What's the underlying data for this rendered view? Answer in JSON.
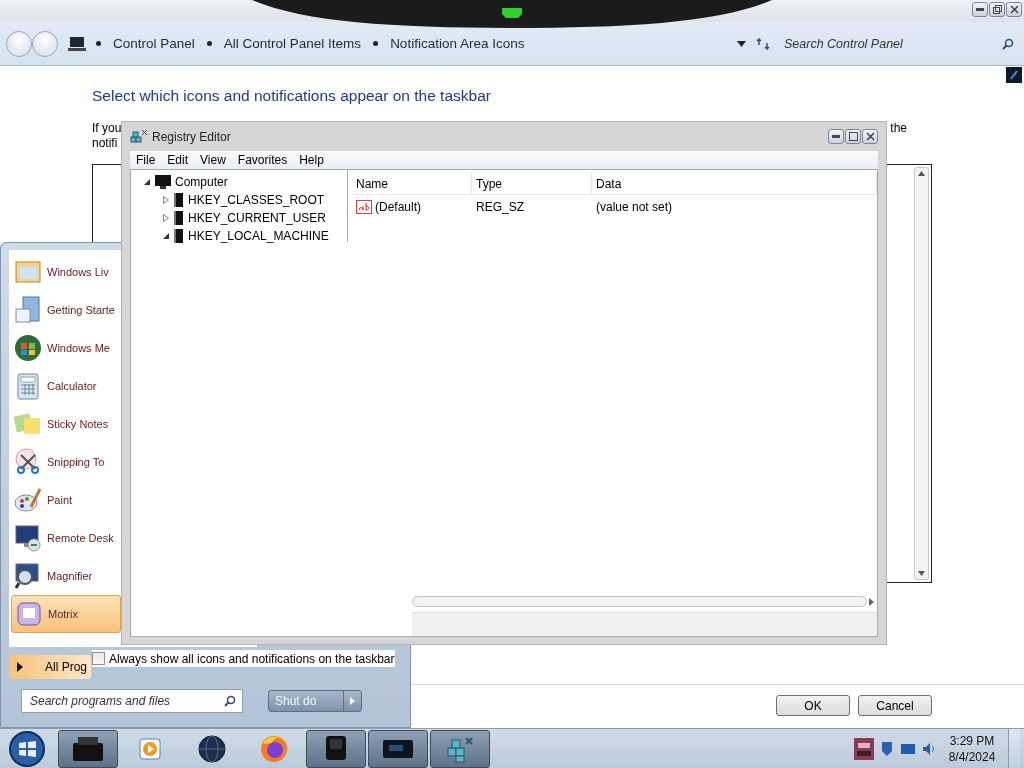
{
  "control_panel": {
    "breadcrumbs": [
      "Control Panel",
      "All Control Panel Items",
      "Notification Area Icons"
    ],
    "search": {
      "placeholder": "Search Control Panel"
    },
    "heading": "Select which icons and notifications appear on the taskbar",
    "intro_fragments": [
      "If you",
      "the",
      "notifi"
    ],
    "always_show": {
      "label": "Always show all icons and notifications on the taskbar",
      "checked": false
    },
    "buttons": [
      "OK",
      "Cancel"
    ]
  },
  "registry_editor": {
    "title": "Registry Editor",
    "menu": [
      "File",
      "Edit",
      "View",
      "Favorites",
      "Help"
    ],
    "tree": [
      {
        "label": "Computer",
        "expanded": true,
        "children": [
          {
            "label": "HKEY_CLASSES_ROOT",
            "expanded": false
          },
          {
            "label": "HKEY_CURRENT_USER",
            "expanded": false
          },
          {
            "label": "HKEY_LOCAL_MACHINE",
            "expanded": true
          }
        ]
      }
    ],
    "columns": [
      "Name",
      "Type",
      "Data"
    ],
    "rows": [
      {
        "name": "(Default)",
        "type": "REG_SZ",
        "data": "(value not set)"
      }
    ]
  },
  "start_menu": {
    "programs": [
      {
        "label": "Windows Liv",
        "kind": "mail",
        "selected": false
      },
      {
        "label": "Getting Starte",
        "kind": "guide",
        "selected": false
      },
      {
        "label": "Windows Me",
        "kind": "media",
        "selected": false
      },
      {
        "label": "Calculator",
        "kind": "calculator",
        "selected": false
      },
      {
        "label": "Sticky Notes",
        "kind": "notes",
        "selected": false
      },
      {
        "label": "Snipping To",
        "kind": "scissors",
        "selected": false
      },
      {
        "label": "Paint",
        "kind": "paint",
        "selected": false
      },
      {
        "label": "Remote Desk",
        "kind": "remote",
        "selected": false
      },
      {
        "label": "Magnifier",
        "kind": "magnifier",
        "selected": false
      },
      {
        "label": "Motrix",
        "kind": "app",
        "selected": true
      }
    ],
    "all_programs": "All Prog",
    "search": {
      "placeholder": "Search programs and files"
    },
    "shutdown": "Shut do"
  },
  "taskbar": {
    "buttons": [
      {
        "kind": "printer",
        "running": true
      },
      {
        "kind": "media",
        "running": false
      },
      {
        "kind": "globe",
        "running": false
      },
      {
        "kind": "browser",
        "running": false
      },
      {
        "kind": "device",
        "running": true
      },
      {
        "kind": "display",
        "running": true
      },
      {
        "kind": "registry",
        "running": true
      }
    ],
    "clock": {
      "time": "3:29 PM",
      "date": "8/4/2024"
    }
  }
}
